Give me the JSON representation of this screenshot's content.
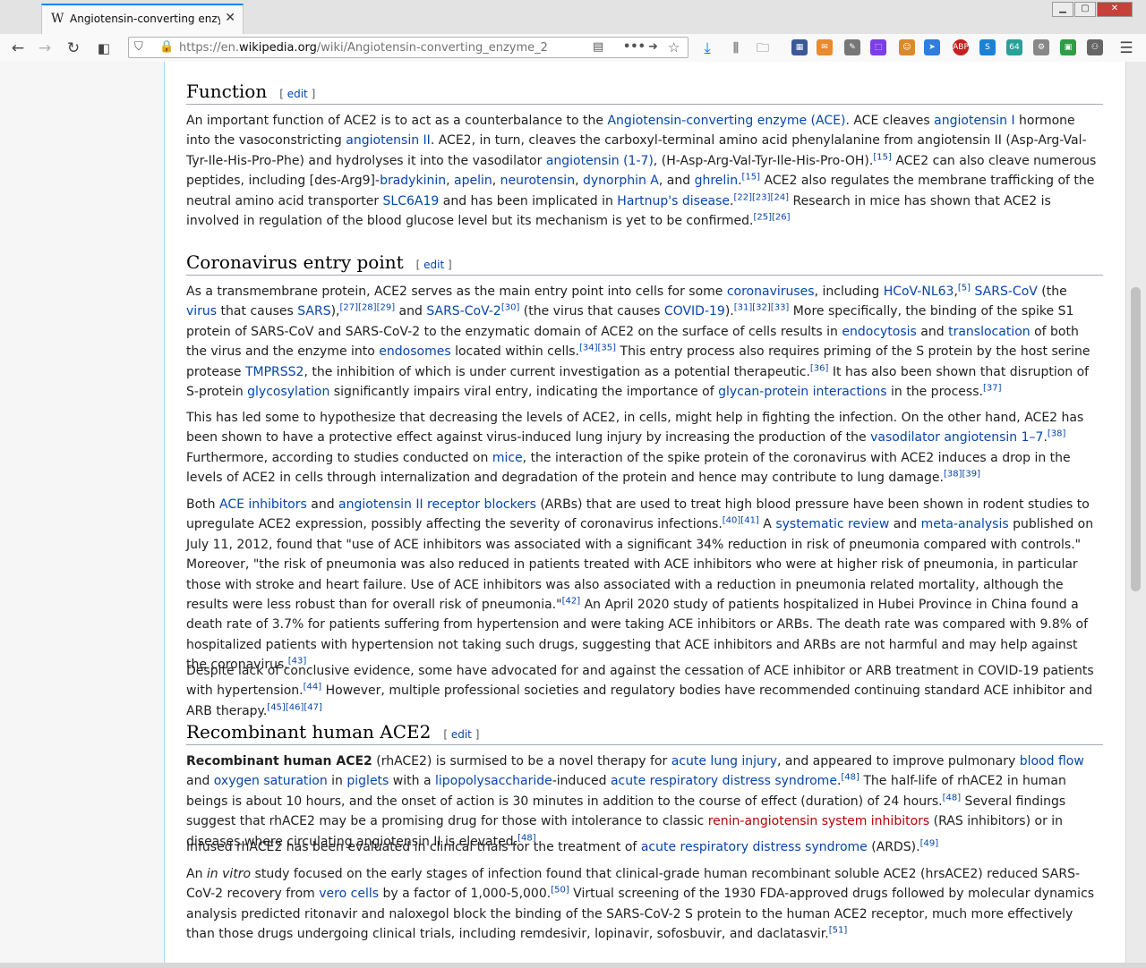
{
  "browser": {
    "tab_favicon": "W",
    "tab_title": "Angiotensin-converting enzyme 2",
    "url_prefix": "https://en.",
    "url_domain": "wikipedia.org",
    "url_path": "/wiki/Angiotensin-converting_enzyme_2",
    "ext_badge": "64",
    "ext_abp": "ABP",
    "ext_s": "S"
  },
  "article": {
    "edit_label": "edit",
    "function": {
      "heading": "Function",
      "p1": [
        {
          "t": "An important function of ACE2 is to act as a counterbalance to the "
        },
        {
          "t": "Angiotensin-converting enzyme (ACE)",
          "link": true
        },
        {
          "t": ". ACE cleaves "
        },
        {
          "t": "angiotensin I",
          "link": true
        },
        {
          "t": " hormone into the vasoconstricting "
        },
        {
          "t": "angiotensin II",
          "link": true
        },
        {
          "t": ". ACE2, in turn, cleaves the carboxyl-terminal amino acid phenylalanine from angiotensin II (Asp-Arg-Val-Tyr-Ile-His-Pro-Phe) and hydrolyses it into the vasodilator "
        },
        {
          "t": "angiotensin (1-7)",
          "link": true
        },
        {
          "t": ", (H-Asp-Arg-Val-Tyr-Ile-His-Pro-OH)."
        },
        {
          "t": "[15]",
          "sup": true
        },
        {
          "t": " ACE2 can also cleave numerous peptides, including [des-Arg9]-"
        },
        {
          "t": "bradykinin",
          "link": true
        },
        {
          "t": ", "
        },
        {
          "t": "apelin",
          "link": true
        },
        {
          "t": ", "
        },
        {
          "t": "neurotensin",
          "link": true
        },
        {
          "t": ", "
        },
        {
          "t": "dynorphin A",
          "link": true
        },
        {
          "t": ", and "
        },
        {
          "t": "ghrelin",
          "link": true
        },
        {
          "t": "."
        },
        {
          "t": "[15]",
          "sup": true
        },
        {
          "t": " ACE2 also regulates the membrane trafficking of the neutral amino acid transporter "
        },
        {
          "t": "SLC6A19",
          "link": true
        },
        {
          "t": " and has been implicated in "
        },
        {
          "t": "Hartnup's disease",
          "link": true
        },
        {
          "t": "."
        },
        {
          "t": "[22][23][24]",
          "sup": true
        },
        {
          "t": " Research in mice has shown that ACE2 is involved in regulation of the blood glucose level but its mechanism is yet to be confirmed."
        },
        {
          "t": "[25][26]",
          "sup": true
        }
      ]
    },
    "coronavirus": {
      "heading": "Coronavirus entry point",
      "p1": [
        {
          "t": "As a transmembrane protein, ACE2 serves as the main entry point into cells for some "
        },
        {
          "t": "coronaviruses",
          "link": true
        },
        {
          "t": ", including "
        },
        {
          "t": "HCoV-NL63",
          "link": true
        },
        {
          "t": ","
        },
        {
          "t": "[5]",
          "sup": true
        },
        {
          "t": " "
        },
        {
          "t": "SARS-CoV",
          "link": true
        },
        {
          "t": " (the "
        },
        {
          "t": "virus",
          "link": true
        },
        {
          "t": " that causes "
        },
        {
          "t": "SARS",
          "link": true
        },
        {
          "t": "),"
        },
        {
          "t": "[27][28][29]",
          "sup": true
        },
        {
          "t": " and "
        },
        {
          "t": "SARS-CoV-2",
          "link": true
        },
        {
          "t": "[30]",
          "sup": true
        },
        {
          "t": " (the virus that causes "
        },
        {
          "t": "COVID-19",
          "link": true
        },
        {
          "t": ")."
        },
        {
          "t": "[31][32][33]",
          "sup": true
        },
        {
          "t": " More specifically, the binding of the spike S1 protein of SARS-CoV and SARS-CoV-2 to the enzymatic domain of ACE2 on the surface of cells results in "
        },
        {
          "t": "endocytosis",
          "link": true
        },
        {
          "t": " and "
        },
        {
          "t": "translocation",
          "link": true
        },
        {
          "t": " of both the virus and the enzyme into "
        },
        {
          "t": "endosomes",
          "link": true
        },
        {
          "t": " located within cells."
        },
        {
          "t": "[34][35]",
          "sup": true
        },
        {
          "t": " This entry process also requires priming of the S protein by the host serine protease "
        },
        {
          "t": "TMPRSS2",
          "link": true
        },
        {
          "t": ", the inhibition of which is under current investigation as a potential therapeutic."
        },
        {
          "t": "[36]",
          "sup": true
        },
        {
          "t": " It has also been shown that disruption of S-protein "
        },
        {
          "t": "glycosylation",
          "link": true
        },
        {
          "t": " significantly impairs viral entry, indicating the importance of "
        },
        {
          "t": "glycan-protein interactions",
          "link": true
        },
        {
          "t": " in the process."
        },
        {
          "t": "[37]",
          "sup": true
        }
      ],
      "p2": [
        {
          "t": "This has led some to hypothesize that decreasing the levels of ACE2, in cells, might help in fighting the infection. On the other hand, ACE2 has been shown to have a protective effect against virus-induced lung injury by increasing the production of the "
        },
        {
          "t": "vasodilator",
          "link": true
        },
        {
          "t": " "
        },
        {
          "t": "angiotensin 1–7",
          "link": true
        },
        {
          "t": "."
        },
        {
          "t": "[38]",
          "sup": true
        },
        {
          "t": " Furthermore, according to studies conducted on "
        },
        {
          "t": "mice",
          "link": true
        },
        {
          "t": ", the interaction of the spike protein of the coronavirus with ACE2 induces a drop in the levels of ACE2 in cells through internalization and degradation of the protein and hence may contribute to lung damage."
        },
        {
          "t": "[38][39]",
          "sup": true
        }
      ],
      "p3": [
        {
          "t": "Both "
        },
        {
          "t": "ACE inhibitors",
          "link": true
        },
        {
          "t": " and "
        },
        {
          "t": "angiotensin II receptor blockers",
          "link": true
        },
        {
          "t": " (ARBs) that are used to treat high blood pressure have been shown in rodent studies to upregulate ACE2 expression, possibly affecting the severity of coronavirus infections."
        },
        {
          "t": "[40][41]",
          "sup": true
        },
        {
          "t": " A "
        },
        {
          "t": "systematic review",
          "link": true
        },
        {
          "t": " and "
        },
        {
          "t": "meta-analysis",
          "link": true
        },
        {
          "t": " published on July 11, 2012, found that \"use of ACE inhibitors was associated with a significant 34% reduction in risk of pneumonia compared with controls.\" Moreover, \"the risk of pneumonia was also reduced in patients treated with ACE inhibitors who were at higher risk of pneumonia, in particular those with stroke and heart failure. Use of ACE inhibitors was also associated with a reduction in pneumonia related mortality, although the results were less robust than for overall risk of pneumonia.\""
        },
        {
          "t": "[42]",
          "sup": true
        },
        {
          "t": " An April 2020 study of patients hospitalized in Hubei Province in China found a death rate of 3.7% for patients suffering from hypertension and were taking ACE inhibitors or ARBs. The death rate was compared with 9.8% of hospitalized patients with hypertension not taking such drugs, suggesting that ACE inhibitors and ARBs are not harmful and may help against the coronavirus."
        },
        {
          "t": "[43]",
          "sup": true
        }
      ],
      "p4": [
        {
          "t": "Despite lack of conclusive evidence, some have advocated for and against the cessation of ACE inhibitor or ARB treatment in COVID-19 patients with hypertension."
        },
        {
          "t": "[44]",
          "sup": true
        },
        {
          "t": " However, multiple professional societies and regulatory bodies have recommended continuing standard ACE inhibitor and ARB therapy."
        },
        {
          "t": "[45][46][47]",
          "sup": true
        }
      ]
    },
    "recombinant": {
      "heading": "Recombinant human ACE2",
      "p1": [
        {
          "t": "Recombinant human ACE2",
          "bold": true
        },
        {
          "t": " (rhACE2) is surmised to be a novel therapy for "
        },
        {
          "t": "acute lung injury",
          "link": true
        },
        {
          "t": ", and appeared to improve pulmonary "
        },
        {
          "t": "blood flow",
          "link": true
        },
        {
          "t": " and "
        },
        {
          "t": "oxygen saturation",
          "link": true
        },
        {
          "t": " in "
        },
        {
          "t": "piglets",
          "link": true
        },
        {
          "t": " with a "
        },
        {
          "t": "lipopolysaccharide",
          "link": true
        },
        {
          "t": "-induced "
        },
        {
          "t": "acute respiratory distress syndrome",
          "link": true
        },
        {
          "t": "."
        },
        {
          "t": "[48]",
          "sup": true
        },
        {
          "t": " The half-life of rhACE2 in human beings is about 10 hours, and the onset of action is 30 minutes in addition to the course of effect (duration) of 24 hours."
        },
        {
          "t": "[48]",
          "sup": true
        },
        {
          "t": " Several findings suggest that rhACE2 may be a promising drug for those with intolerance to classic "
        },
        {
          "t": "renin-angiotensin system inhibitors",
          "link": true,
          "new": true
        },
        {
          "t": " (RAS inhibitors) or in diseases where circulating angiotensin II is elevated."
        },
        {
          "t": "[48]",
          "sup": true
        }
      ],
      "p2": [
        {
          "t": "Infused rhACE2 has been evaluated in clinical trials for the treatment of "
        },
        {
          "t": "acute respiratory distress syndrome",
          "link": true
        },
        {
          "t": " (ARDS)."
        },
        {
          "t": "[49]",
          "sup": true
        }
      ],
      "p3": [
        {
          "t": "An "
        },
        {
          "t": "in vitro",
          "italic": true
        },
        {
          "t": " study focused on the early stages of infection found that clinical-grade human recombinant soluble ACE2 (hrsACE2) reduced SARS-CoV-2 recovery from "
        },
        {
          "t": "vero cells",
          "link": true
        },
        {
          "t": " by a factor of 1,000-5,000."
        },
        {
          "t": "[50]",
          "sup": true
        },
        {
          "t": " Virtual screening of the 1930 FDA-approved drugs followed by molecular dynamics analysis predicted ritonavir and naloxegol block the binding of the SARS-CoV-2 S protein to the human ACE2 receptor, much more effectively than those drugs undergoing clinical trials, including remdesivir, lopinavir, sofosbuvir, and daclatasvir."
        },
        {
          "t": "[51]",
          "sup": true
        }
      ]
    }
  }
}
